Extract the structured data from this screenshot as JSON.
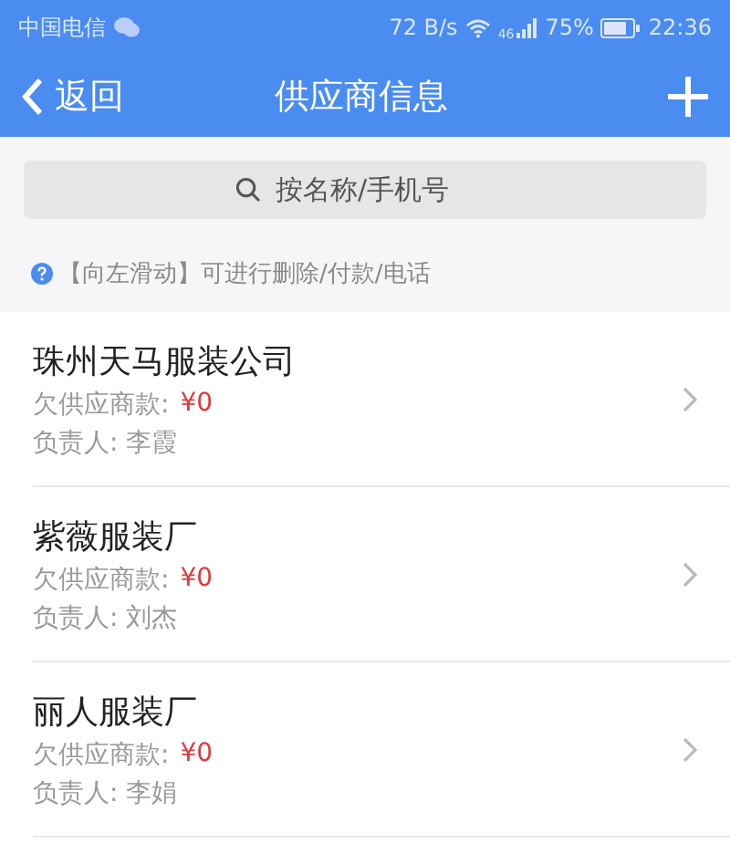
{
  "status_bar": {
    "carrier": "中国电信",
    "speed": "72 B/s",
    "network": "46",
    "battery": "75%",
    "time": "22:36"
  },
  "header": {
    "back": "返回",
    "title": "供应商信息"
  },
  "search": {
    "placeholder": "按名称/手机号"
  },
  "hint": "【向左滑动】可进行删除/付款/电话",
  "suppliers": [
    {
      "name": "珠州天马服装公司",
      "debt_label": "欠供应商款:",
      "debt": "¥0",
      "contact": "负责人: 李霞"
    },
    {
      "name": "紫薇服装厂",
      "debt_label": "欠供应商款:",
      "debt": "¥0",
      "contact": "负责人: 刘杰"
    },
    {
      "name": "丽人服装厂",
      "debt_label": "欠供应商款:",
      "debt": "¥0",
      "contact": "负责人: 李娟"
    }
  ]
}
